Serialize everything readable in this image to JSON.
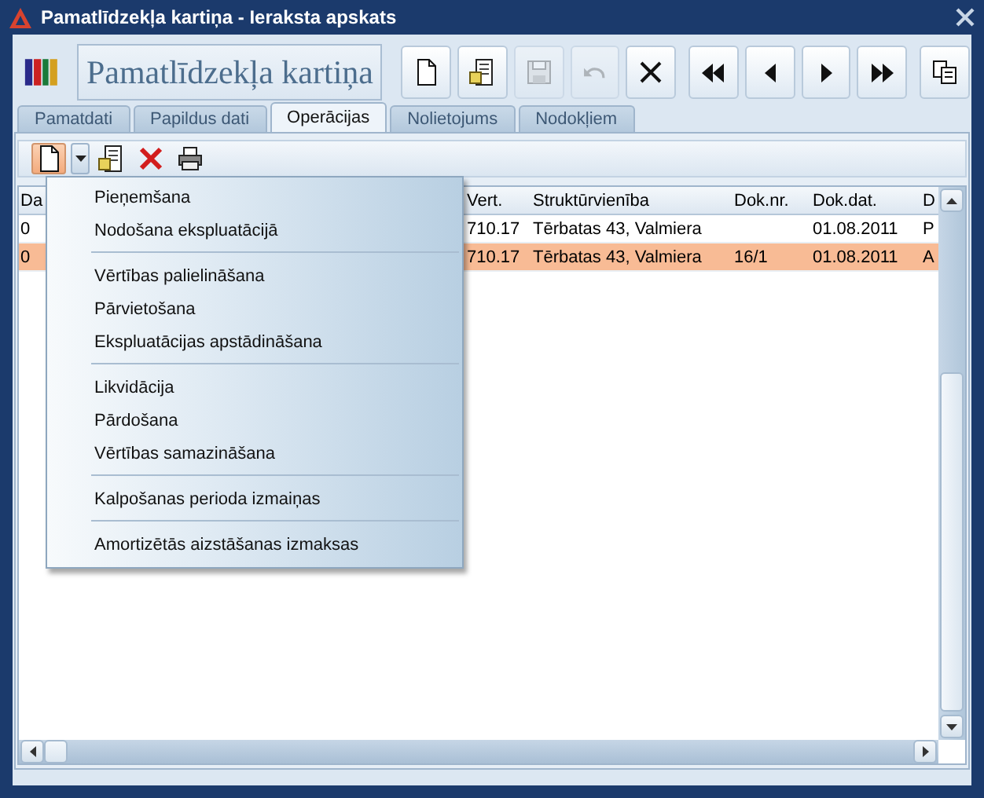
{
  "window": {
    "title": "Pamatlīdzekļa kartiņa - Ieraksta apskats"
  },
  "header": {
    "title": "Pamatlīdzekļa kartiņa"
  },
  "toolbar": [
    {
      "kind": "new",
      "disabled": false
    },
    {
      "kind": "edit",
      "disabled": false
    },
    {
      "kind": "save",
      "disabled": true
    },
    {
      "kind": "undo",
      "disabled": true
    },
    {
      "kind": "delete",
      "disabled": false
    },
    {
      "kind": "first",
      "disabled": false
    },
    {
      "kind": "prev",
      "disabled": false
    },
    {
      "kind": "next",
      "disabled": false
    },
    {
      "kind": "last",
      "disabled": false
    },
    {
      "kind": "copy",
      "disabled": false
    }
  ],
  "tabs": [
    {
      "label": "Pamatdati",
      "selected": false
    },
    {
      "label": "Papildus dati",
      "selected": false
    },
    {
      "label": "Operācijas",
      "selected": true
    },
    {
      "label": "Nolietojums",
      "selected": false
    },
    {
      "label": "Nodokļiem",
      "selected": false
    }
  ],
  "subtoolbar": [
    {
      "kind": "new",
      "pressed": true
    },
    {
      "kind": "dropdown",
      "pressed": false
    },
    {
      "kind": "edit",
      "pressed": false
    },
    {
      "kind": "delete",
      "pressed": false
    },
    {
      "kind": "print",
      "pressed": false
    }
  ],
  "table": {
    "columns": [
      "Da",
      "Vert.",
      "Struktūrvienība",
      "Dok.nr.",
      "Dok.dat.",
      "D"
    ],
    "rows": [
      {
        "selected": false,
        "cells": [
          "0",
          "710.17",
          "Tērbatas 43, Valmiera",
          "",
          "01.08.2011",
          "P"
        ]
      },
      {
        "selected": true,
        "cells": [
          "0",
          "710.17",
          "Tērbatas 43, Valmiera",
          "16/1",
          "01.08.2011",
          "A"
        ]
      }
    ]
  },
  "menu": {
    "groups": [
      [
        "Pieņemšana",
        "Nodošana ekspluatācijā"
      ],
      [
        "Vērtības palielināšana",
        "Pārvietošana",
        "Ekspluatācijas apstādināšana"
      ],
      [
        "Likvidācija",
        "Pārdošana",
        "Vērtības samazināšana"
      ],
      [
        "Kalpošanas perioda izmaiņas"
      ],
      [
        "Amortizētās aizstāšanas izmaksas"
      ]
    ]
  }
}
